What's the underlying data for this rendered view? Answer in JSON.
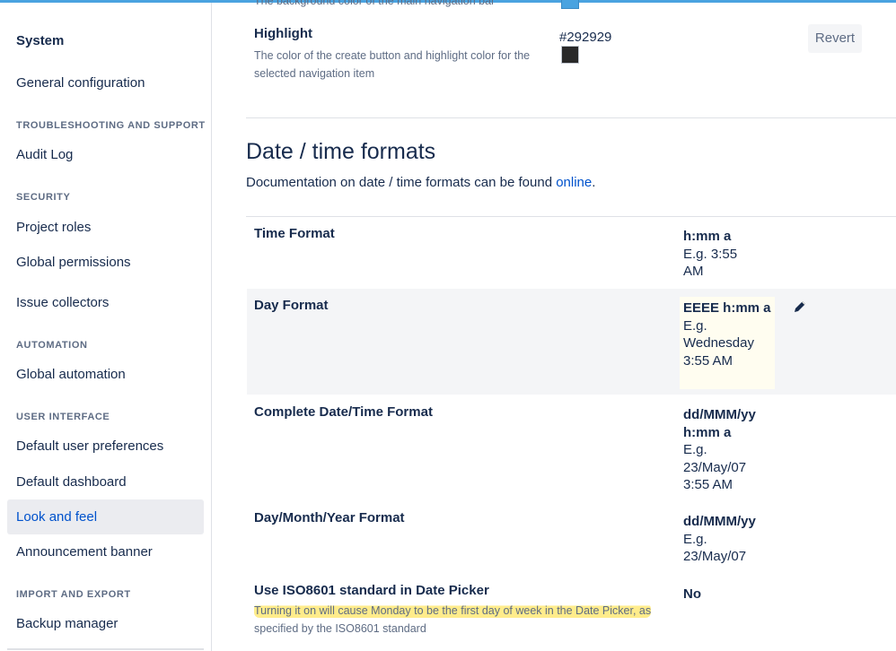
{
  "sidebar": {
    "title": "System",
    "general": "General configuration",
    "sections": {
      "troubleshooting": "TROUBLESHOOTING AND SUPPORT",
      "security": "SECURITY",
      "automation": "AUTOMATION",
      "user_interface": "USER INTERFACE",
      "import_export": "IMPORT AND EXPORT"
    },
    "items": {
      "audit_log": "Audit Log",
      "project_roles": "Project roles",
      "global_permissions": "Global permissions",
      "issue_collectors": "Issue collectors",
      "global_automation": "Global automation",
      "default_user_preferences": "Default user preferences",
      "default_dashboard": "Default dashboard",
      "look_and_feel": "Look and feel",
      "announcement_banner": "Announcement banner",
      "backup_manager": "Backup manager"
    },
    "active_item": "Look and feel"
  },
  "colors_section": {
    "cut_off_text": "The background color of the main navigation bar",
    "nav_swatch_color": "#4aa3e0",
    "highlight": {
      "label": "Highlight",
      "description": "The color of the create button and highlight color for the selected navigation item",
      "hex": "#292929",
      "swatch_color": "#292929",
      "revert_label": "Revert"
    }
  },
  "date_time": {
    "title": "Date / time formats",
    "description": "Documentation on date / time formats can be found",
    "link_text": "online",
    "link_suffix": ".",
    "rows": {
      "time": {
        "label": "Time Format",
        "value": "h:mm a",
        "example": "E.g. 3:55 AM"
      },
      "day": {
        "label": "Day Format",
        "value": "EEEE h:mm a",
        "example": "E.g. Wednesday 3:55 AM"
      },
      "complete": {
        "label": "Complete Date/Time Format",
        "value": "dd/MMM/yy h:mm a",
        "example": "E.g. 23/May/07 3:55 AM"
      },
      "dmy": {
        "label": "Day/Month/Year Format",
        "value": "dd/MMM/yy",
        "example": "E.g. 23/May/07"
      },
      "iso": {
        "label": "Use ISO8601 standard in Date Picker",
        "value": "No",
        "description_highlighted": "Turning it on will cause Monday to be the first day of week in the Date Picker, as",
        "description_rest": "specified by the ISO8601 standard"
      }
    }
  },
  "icons": {
    "pencil": "pencil-icon"
  }
}
